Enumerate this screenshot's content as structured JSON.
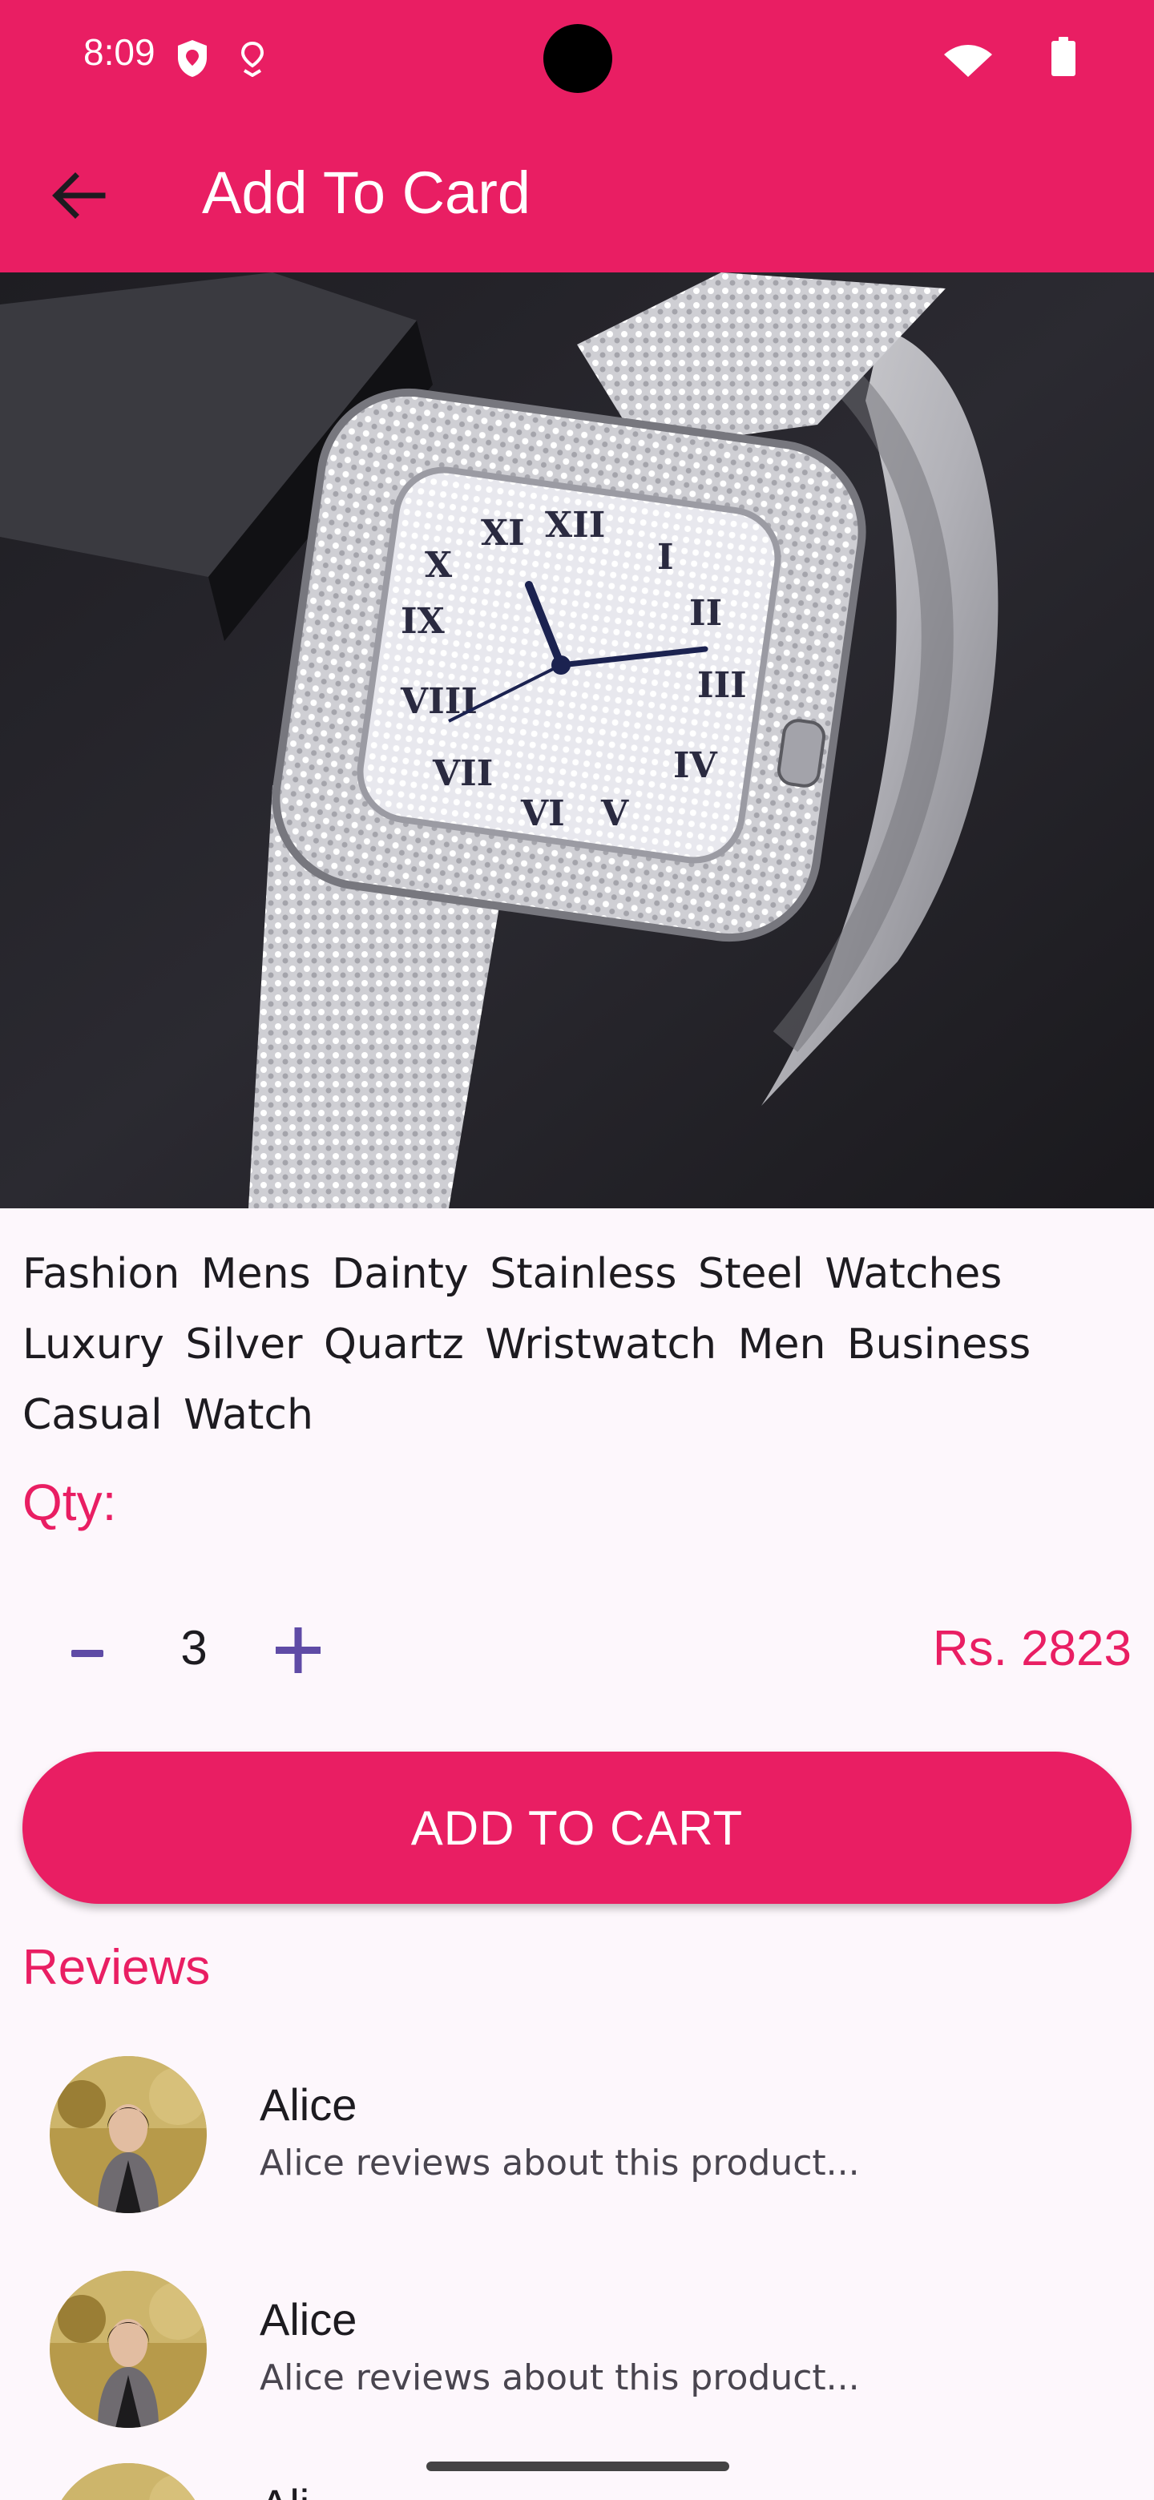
{
  "status_bar": {
    "time": "8:09"
  },
  "app_bar": {
    "title": "Add To Card",
    "back_icon": "arrow-back-icon",
    "background": "#e91e63"
  },
  "product": {
    "title": "Fashion Mens Dainty Stainless Steel Watches Luxury Silver Quartz Wristwatch Men Business Casual Watch",
    "image": "silver-diamond-watch-photo",
    "qty_label": "Qty:",
    "qty_minus": "-",
    "quantity": "3",
    "qty_plus": "+",
    "price": "Rs. 2823"
  },
  "cart_button": {
    "label": "ADD TO CART"
  },
  "reviews": {
    "heading": "Reviews",
    "items": [
      {
        "name": "Alice",
        "text": "Alice reviews about this product..."
      },
      {
        "name": "Alice",
        "text": "Alice reviews about this product..."
      },
      {
        "name": "Ali",
        "text": ""
      }
    ]
  },
  "colors": {
    "accent": "#e91e63",
    "stepper": "#5f4ba6",
    "background": "#fdf7fc"
  }
}
